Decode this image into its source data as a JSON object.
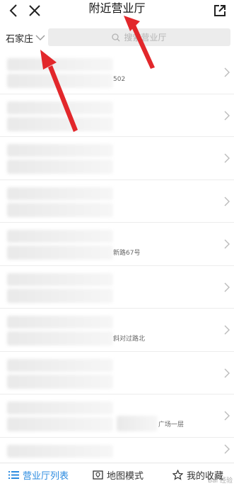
{
  "header": {
    "title": "附近营业厅"
  },
  "search": {
    "city": "石家庄",
    "placeholder": "搜索营业厅"
  },
  "list": {
    "items": [
      {
        "address_fragment": "502"
      },
      {
        "address_fragment": ""
      },
      {
        "address_fragment": ""
      },
      {
        "address_fragment": ""
      },
      {
        "address_fragment": "新路67号"
      },
      {
        "address_fragment": ""
      },
      {
        "address_fragment": "斜对过路北"
      },
      {
        "address_fragment": ""
      },
      {
        "address_fragment": "广场一层"
      },
      {
        "address_fragment": ""
      }
    ]
  },
  "tabs": [
    {
      "label": "营业厅列表",
      "icon": "list-icon",
      "active": true
    },
    {
      "label": "地图模式",
      "icon": "map-icon",
      "active": false
    },
    {
      "label": "我的收藏",
      "icon": "star-icon",
      "active": false
    }
  ],
  "watermark": "Bai 经验",
  "colors": {
    "accent": "#2d8ce0",
    "annotation": "#e2272b"
  }
}
